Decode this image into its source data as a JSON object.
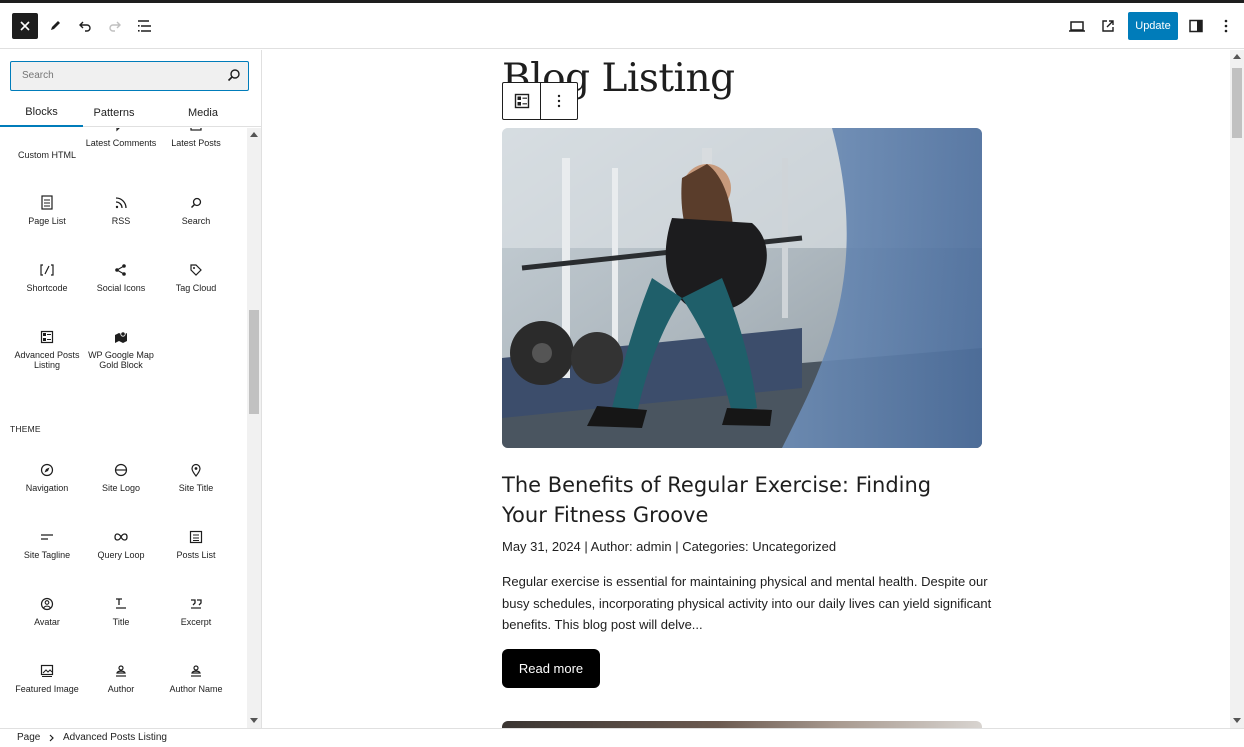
{
  "header": {
    "close_icon": "close-icon",
    "update_label": "Update"
  },
  "sidebar": {
    "search_placeholder": "Search",
    "tabs": [
      {
        "label": "Blocks",
        "active": true
      },
      {
        "label": "Patterns",
        "active": false
      },
      {
        "label": "Media",
        "active": false
      }
    ],
    "widget_blocks": [
      {
        "label": "Custom HTML",
        "icon": "html-icon"
      },
      {
        "label": "Latest Comments",
        "icon": "comment-icon"
      },
      {
        "label": "Latest Posts",
        "icon": "posts-icon"
      },
      {
        "label": "Page List",
        "icon": "page-list-icon"
      },
      {
        "label": "RSS",
        "icon": "rss-icon"
      },
      {
        "label": "Search",
        "icon": "search-icon"
      },
      {
        "label": "Shortcode",
        "icon": "shortcode-icon"
      },
      {
        "label": "Social Icons",
        "icon": "share-icon"
      },
      {
        "label": "Tag Cloud",
        "icon": "tag-icon"
      },
      {
        "label": "Advanced Posts Listing",
        "icon": "posts-listing-icon"
      },
      {
        "label": "WP Google Map Gold Block",
        "icon": "map-icon"
      }
    ],
    "theme_title": "THEME",
    "theme_blocks": [
      {
        "label": "Navigation",
        "icon": "compass-icon"
      },
      {
        "label": "Site Logo",
        "icon": "site-logo-icon"
      },
      {
        "label": "Site Title",
        "icon": "map-pin-icon"
      },
      {
        "label": "Site Tagline",
        "icon": "tagline-icon"
      },
      {
        "label": "Query Loop",
        "icon": "loop-icon"
      },
      {
        "label": "Posts List",
        "icon": "list-icon"
      },
      {
        "label": "Avatar",
        "icon": "avatar-icon"
      },
      {
        "label": "Title",
        "icon": "title-icon"
      },
      {
        "label": "Excerpt",
        "icon": "quote-icon"
      },
      {
        "label": "Featured Image",
        "icon": "image-icon"
      },
      {
        "label": "Author",
        "icon": "author-icon"
      },
      {
        "label": "Author Name",
        "icon": "author-name-icon"
      }
    ]
  },
  "canvas": {
    "page_heading": "Blog Listing",
    "post": {
      "title": "The Benefits of Regular Exercise: Finding Your Fitness Groove",
      "meta": "May 31, 2024 | Author: admin | Categories: Uncategorized",
      "excerpt": "Regular exercise is essential for maintaining physical and mental health. Despite our busy schedules, incorporating physical activity into our daily lives can yield significant benefits. This blog post will delve...",
      "read_more": "Read more"
    }
  },
  "breadcrumb": {
    "items": [
      "Page",
      "Advanced Posts Listing"
    ]
  },
  "colors": {
    "accent": "#007cba",
    "dark": "#1e1e1e"
  }
}
